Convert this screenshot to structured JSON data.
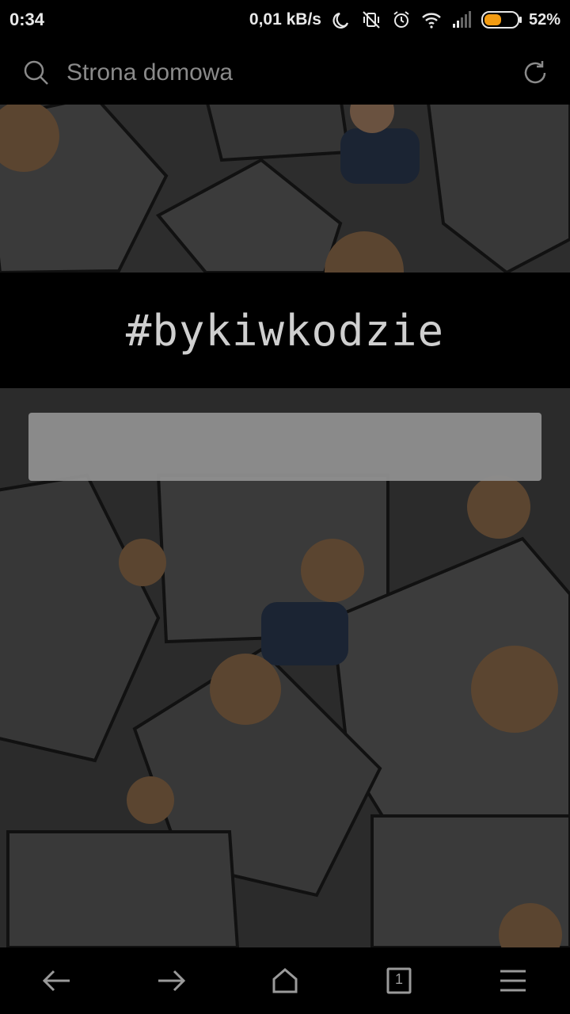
{
  "status_bar": {
    "time": "0:34",
    "speed": "0,01 kB/s",
    "battery_percent": "52%",
    "battery_level": 0.52,
    "icons": [
      "moon-icon",
      "vibrate-mute-icon",
      "alarm-icon",
      "wifi-icon",
      "signal-icon",
      "battery-icon"
    ]
  },
  "browser": {
    "search_placeholder": "Strona domowa"
  },
  "page": {
    "title": "#bykiwkodzie",
    "background_pattern": "blah blah",
    "input_value": ""
  },
  "navigation": {
    "tab_count": "1",
    "buttons": [
      "back-icon",
      "forward-icon",
      "home-icon",
      "tabs-icon",
      "menu-icon"
    ]
  },
  "colors": {
    "accent_battery": "#f39c12",
    "background": "#000000",
    "title_text": "#cfcfcf"
  }
}
